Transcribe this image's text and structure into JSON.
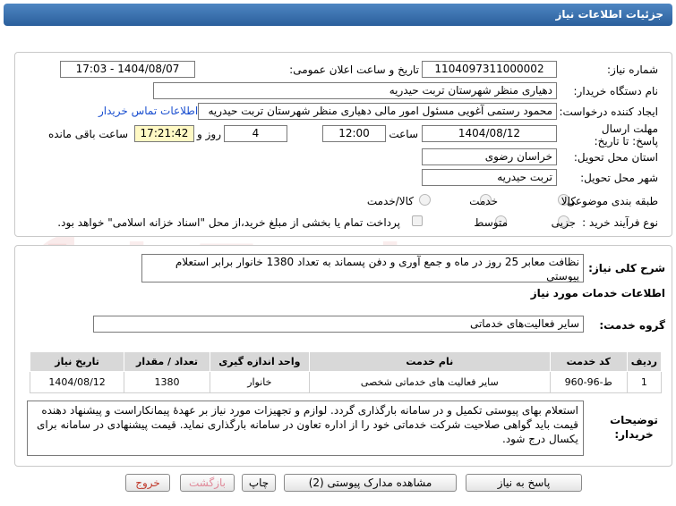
{
  "window": {
    "title": "جزئیات اطلاعات نیاز"
  },
  "form": {
    "need_number_label": "شماره نیاز:",
    "need_number": "1104097311000002",
    "announce_label": "تاریخ و ساعت اعلان عمومی:",
    "announce_value": "1404/08/07 - 17:03",
    "buyer_org_label": "نام دستگاه خریدار:",
    "buyer_org": "دهیاری منظر  شهرستان تربت حیدریه",
    "creator_label": "ایجاد کننده درخواست:",
    "creator": "محمود رستمی آغویی مسئول امور مالی  دهیاری منظر  شهرستان تربت حیدریه",
    "contact_link": "اطلاعات تماس خریدار",
    "deadline_label": "مهلت ارسال پاسخ: تا تاریخ:",
    "deadline_date": "1404/08/12",
    "time_label": "ساعت",
    "deadline_time": "12:00",
    "days": "4",
    "days_label": "روز و",
    "remaining_time": "17:21:42",
    "remaining_label": "ساعت باقی مانده",
    "province_label": "استان محل تحویل:",
    "province": "خراسان رضوی",
    "city_label": "شهر محل تحویل:",
    "city": "تربت حیدریه",
    "category_label": "طبقه بندی موضوعی:",
    "category_options": [
      "کالا",
      "خدمت",
      "کالا/خدمت"
    ],
    "process_label": "نوع فرآیند خرید :",
    "process_options": [
      "جزیی",
      "متوسط"
    ],
    "payment_note": "پرداخت تمام یا بخشی از مبلغ خرید،از محل \"اسناد خزانه اسلامی\" خواهد بود."
  },
  "details": {
    "description_label": "شرح کلی نیاز:",
    "description": "نظافت معابر 25 روز در ماه و جمع آوری و دفن پسماند به تعداد 1380 خانوار برابر استعلام پیوستی",
    "services_header": "اطلاعات خدمات مورد نیاز",
    "service_group_label": "گروه خدمت:",
    "service_group": "سایر فعالیت‌های خدماتی",
    "table": {
      "headers": [
        "ردیف",
        "کد خدمت",
        "نام خدمت",
        "واحد اندازه گیری",
        "تعداد / مقدار",
        "تاریخ نیاز"
      ],
      "rows": [
        [
          "1",
          "ط-96-960",
          "سایر فعالیت های خدماتی شخصی",
          "خانوار",
          "1380",
          "1404/08/12"
        ]
      ]
    },
    "buyer_notes_label": "توضیحات خریدار:",
    "buyer_notes": "استعلام بهای پیوستی تکمیل و در سامانه بارگذاری گردد. لوازم و تجهیزات مورد نیاز بر عهدهٔ پیمانکاراست و پیشنهاد دهنده قیمت باید گواهی صلاحیت شرکت خدماتی خود را از اداره تعاون در سامانه بارگذاری نماید. قیمت پیشنهادی در سامانه برای یکسال درج شود."
  },
  "buttons": {
    "respond": "پاسخ به نیاز",
    "attachments": "مشاهده مدارک پیوستی (2)",
    "print": "چاپ",
    "back": "بازگشت",
    "exit": "خروج"
  },
  "watermark": {
    "text": "AriaTender.net"
  },
  "colors": {
    "title_bar": "#2b5f9c",
    "highlight": "#fff9c4",
    "link": "#1a4fd0",
    "exit_text": "#c0392b",
    "back_text": "#e08a9a"
  }
}
